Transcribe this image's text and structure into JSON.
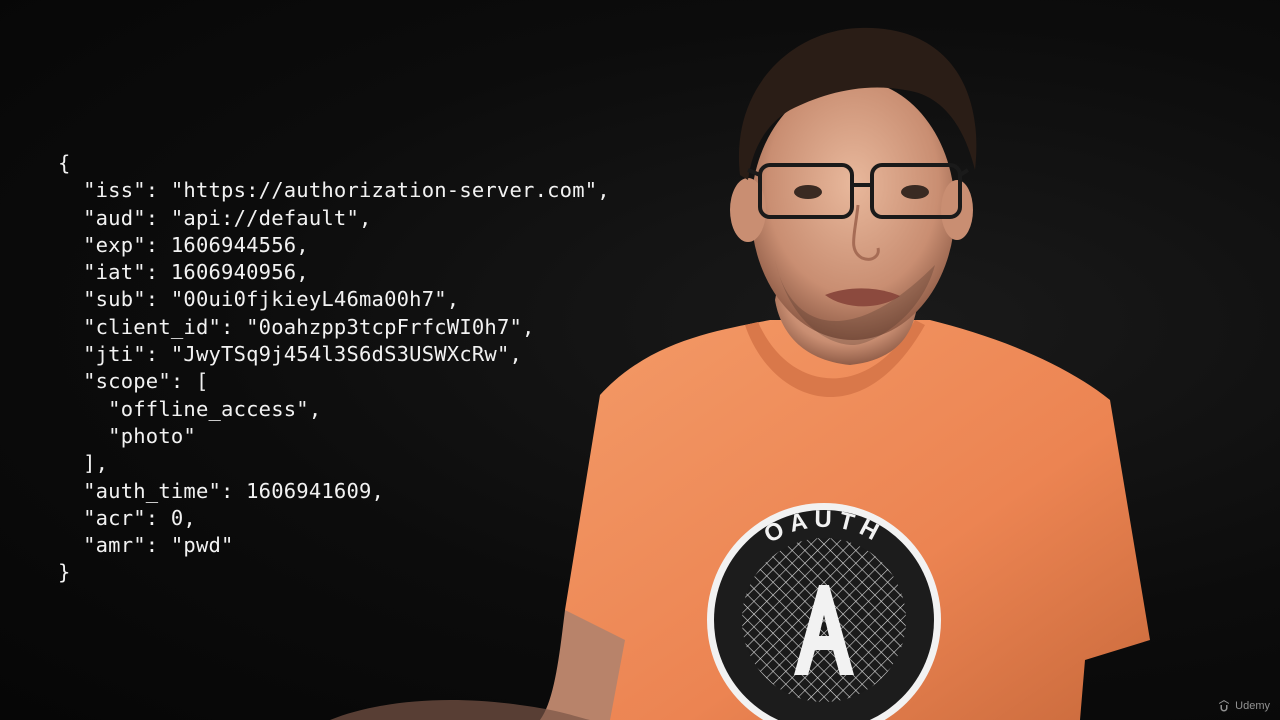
{
  "code": {
    "lines": [
      "{",
      "  \"iss\": \"https://authorization-server.com\",",
      "  \"aud\": \"api://default\",",
      "  \"exp\": 1606944556,",
      "  \"iat\": 1606940956,",
      "  \"sub\": \"00ui0fjkieyL46ma00h7\",",
      "  \"client_id\": \"0oahzpp3tcpFrfcWI0h7\",",
      "  \"jti\": \"JwyTSq9j454l3S6dS3USWXcRw\",",
      "  \"scope\": [",
      "    \"offline_access\",",
      "    \"photo\"",
      "  ],",
      "  \"auth_time\": 1606941609,",
      "  \"acr\": 0,",
      "  \"amr\": \"pwd\"",
      "}"
    ]
  },
  "shirt": {
    "logo_top_text": "OAUTH",
    "logo_letter": "A",
    "color": "#f08a55"
  },
  "watermark": {
    "text": "Udemy",
    "icon": "udemy-logo-icon"
  },
  "colors": {
    "background": "#0b0b0b",
    "code_text": "#f2f2f2",
    "shirt": "#f08a55"
  }
}
